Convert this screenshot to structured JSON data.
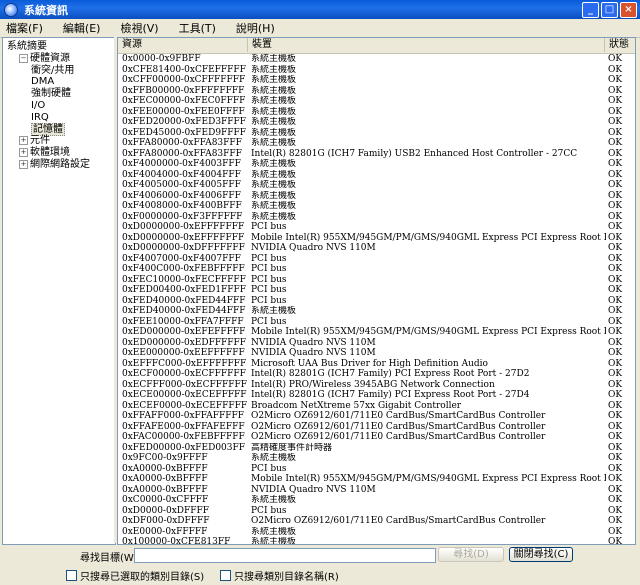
{
  "window": {
    "title": "系統資訊"
  },
  "menu": [
    "檔案(F)",
    "編輯(E)",
    "檢視(V)",
    "工具(T)",
    "說明(H)"
  ],
  "tree": [
    {
      "label": "系統摘要",
      "level": 0,
      "expander": ""
    },
    {
      "label": "硬體資源",
      "level": 1,
      "expander": "−"
    },
    {
      "label": "衝突/共用",
      "level": 2,
      "expander": ""
    },
    {
      "label": "DMA",
      "level": 2,
      "expander": ""
    },
    {
      "label": "強制硬體",
      "level": 2,
      "expander": ""
    },
    {
      "label": "I/O",
      "level": 2,
      "expander": ""
    },
    {
      "label": "IRQ",
      "level": 2,
      "expander": ""
    },
    {
      "label": "記憶體",
      "level": 2,
      "expander": "",
      "selected": true
    },
    {
      "label": "元件",
      "level": 1,
      "expander": "+"
    },
    {
      "label": "軟體環境",
      "level": 1,
      "expander": "+"
    },
    {
      "label": "網際網路設定",
      "level": 1,
      "expander": "+"
    }
  ],
  "list": {
    "headers": [
      "資源",
      "裝置",
      "狀態"
    ],
    "rows": [
      [
        "0x0000-0x9FBFF",
        "系統主機板",
        "OK"
      ],
      [
        "0xCFE81400-0xCFEFFFFF",
        "系統主機板",
        "OK"
      ],
      [
        "0xCFF00000-0xCFFFFFFF",
        "系統主機板",
        "OK"
      ],
      [
        "0xFFB00000-0xFFFFFFFF",
        "系統主機板",
        "OK"
      ],
      [
        "0xFEC00000-0xFEC0FFFF",
        "系統主機板",
        "OK"
      ],
      [
        "0xFEE00000-0xFEE0FFFF",
        "系統主機板",
        "OK"
      ],
      [
        "0xFED20000-0xFED3FFFF",
        "系統主機板",
        "OK"
      ],
      [
        "0xFED45000-0xFED9FFFF",
        "系統主機板",
        "OK"
      ],
      [
        "0xFFA80000-0xFFA83FFF",
        "系統主機板",
        "OK"
      ],
      [
        "0xFFA80000-0xFFA83FFF",
        "Intel(R) 82801G (ICH7 Family) USB2 Enhanced Host Controller - 27CC",
        "OK"
      ],
      [
        "0xF4000000-0xF4003FFF",
        "系統主機板",
        "OK"
      ],
      [
        "0xF4004000-0xF4004FFF",
        "系統主機板",
        "OK"
      ],
      [
        "0xF4005000-0xF4005FFF",
        "系統主機板",
        "OK"
      ],
      [
        "0xF4006000-0xF4006FFF",
        "系統主機板",
        "OK"
      ],
      [
        "0xF4008000-0xF400BFFF",
        "系統主機板",
        "OK"
      ],
      [
        "0xF0000000-0xF3FFFFFF",
        "系統主機板",
        "OK"
      ],
      [
        "0xD0000000-0xEFFFFFFF",
        "PCI bus",
        "OK"
      ],
      [
        "0xD0000000-0xEFFFFFFF",
        "Mobile Intel(R) 955XM/945GM/PM/GMS/940GML Express PCI Express Root Port - 27A1",
        "OK"
      ],
      [
        "0xD0000000-0xDFFFFFFF",
        "NVIDIA Quadro NVS 110M",
        "OK"
      ],
      [
        "0xF4007000-0xF4007FFF",
        "PCI bus",
        "OK"
      ],
      [
        "0xF400C000-0xFEBFFFFF",
        "PCI bus",
        "OK"
      ],
      [
        "0xFEC10000-0xFECFFFFF",
        "PCI bus",
        "OK"
      ],
      [
        "0xFED00400-0xFED1FFFF",
        "PCI bus",
        "OK"
      ],
      [
        "0xFED40000-0xFED44FFF",
        "PCI bus",
        "OK"
      ],
      [
        "0xFED40000-0xFED44FFF",
        "系統主機板",
        "OK"
      ],
      [
        "0xFEE10000-0xFFA7FFFF",
        "PCI bus",
        "OK"
      ],
      [
        "0xED000000-0xEFEFFFFF",
        "Mobile Intel(R) 955XM/945GM/PM/GMS/940GML Express PCI Express Root Port - 27A1",
        "OK"
      ],
      [
        "0xED000000-0xEDFFFFFF",
        "NVIDIA Quadro NVS 110M",
        "OK"
      ],
      [
        "0xEE000000-0xEEFFFFFF",
        "NVIDIA Quadro NVS 110M",
        "OK"
      ],
      [
        "0xEFFFC000-0xEFFFFFFF",
        "Microsoft UAA Bus Driver for High Definition Audio",
        "OK"
      ],
      [
        "0xECF00000-0xECFFFFFF",
        "Intel(R) 82801G (ICH7 Family) PCI Express Root Port - 27D2",
        "OK"
      ],
      [
        "0xECFFF000-0xECFFFFFF",
        "Intel(R) PRO/Wireless 3945ABG Network Connection",
        "OK"
      ],
      [
        "0xECE00000-0xECEFFFFF",
        "Intel(R) 82801G (ICH7 Family) PCI Express Root Port - 27D4",
        "OK"
      ],
      [
        "0xECEF0000-0xECEFFFFF",
        "Broadcom NetXtreme 57xx Gigabit Controller",
        "OK"
      ],
      [
        "0xFFAFF000-0xFFAFFFFF",
        "O2Micro OZ6912/601/711E0 CardBus/SmartCardBus Controller",
        "OK"
      ],
      [
        "0xFFAFE000-0xFFAFEFFF",
        "O2Micro OZ6912/601/711E0 CardBus/SmartCardBus Controller",
        "OK"
      ],
      [
        "0xFAC00000-0xFEBFFFFF",
        "O2Micro OZ6912/601/711E0 CardBus/SmartCardBus Controller",
        "OK"
      ],
      [
        "0xFED00000-0xFED003FF",
        "高精確度事件計時器",
        "OK"
      ],
      [
        "0x9FC00-0x9FFFF",
        "系統主機板",
        "OK"
      ],
      [
        "0xA0000-0xBFFFF",
        "PCI bus",
        "OK"
      ],
      [
        "0xA0000-0xBFFFF",
        "Mobile Intel(R) 955XM/945GM/PM/GMS/940GML Express PCI Express Root Port - 27A1",
        "OK"
      ],
      [
        "0xA0000-0xBFFFF",
        "NVIDIA Quadro NVS 110M",
        "OK"
      ],
      [
        "0xC0000-0xCFFFF",
        "系統主機板",
        "OK"
      ],
      [
        "0xD0000-0xDFFFF",
        "PCI bus",
        "OK"
      ],
      [
        "0xDF000-0xDFFFF",
        "O2Micro OZ6912/601/711E0 CardBus/SmartCardBus Controller",
        "OK"
      ],
      [
        "0xE0000-0xFFFFF",
        "系統主機板",
        "OK"
      ],
      [
        "0x100000-0xCFE813FF",
        "系統主機板",
        "OK"
      ]
    ]
  },
  "find": {
    "label": "尋找目標(W):",
    "value": "",
    "find_button": "尋找(D)",
    "close_button": "關閉尋找(C)",
    "option_selected": "只搜尋已選取的類別目錄(S)",
    "option_names": "只搜尋類別目錄名稱(R)"
  }
}
